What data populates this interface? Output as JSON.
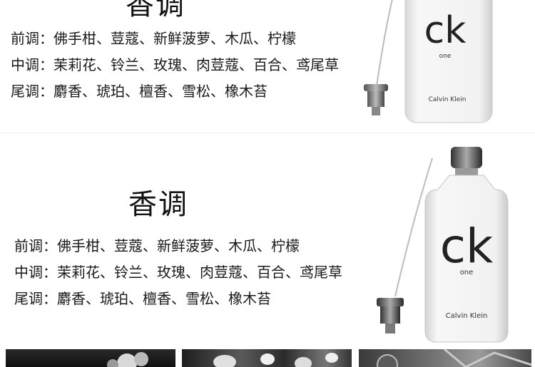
{
  "section1": {
    "heading": "香调",
    "notes": [
      "前调：佛手柑、荳蔻、新鲜菠萝、木瓜、柠檬",
      "中调：茉莉花、铃兰、玫瑰、肉荳蔻、百合、鸢尾草",
      "尾调：麝香、琥珀、檀香、雪松、橡木苔"
    ],
    "bottle": {
      "logo": "ck",
      "sub": "one",
      "brand": "Calvin Klein"
    }
  },
  "section2": {
    "heading": "香调",
    "notes": [
      "前调：佛手柑、荳蔻、新鲜菠萝、木瓜、柠檬",
      "中调：茉莉花、铃兰、玫瑰、肉荳蔻、百合、鸢尾草",
      "尾调：麝香、琥珀、檀香、雪松、橡木苔"
    ],
    "bottle": {
      "logo": "ck",
      "sub": "one",
      "brand": "Calvin Klein"
    }
  },
  "photos": [
    {
      "name": "photo-strip-left",
      "tone": "dark"
    },
    {
      "name": "photo-strip-middle",
      "tone": "flowers"
    },
    {
      "name": "photo-strip-right",
      "tone": "grey"
    }
  ]
}
